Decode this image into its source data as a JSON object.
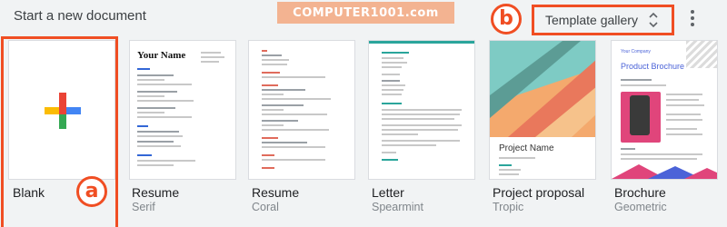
{
  "header": {
    "title": "Start a new document",
    "watermark": "COMPUTER1001.com",
    "gallery_label": "Template gallery"
  },
  "annotations": {
    "a": "a",
    "b": "b"
  },
  "templates": [
    {
      "label": "Blank",
      "sub": ""
    },
    {
      "label": "Resume",
      "sub": "Serif"
    },
    {
      "label": "Resume",
      "sub": "Coral"
    },
    {
      "label": "Letter",
      "sub": "Spearmint"
    },
    {
      "label": "Project proposal",
      "sub": "Tropic"
    },
    {
      "label": "Brochure",
      "sub": "Geometric"
    }
  ],
  "previews": {
    "serif_name": "Your Name",
    "project_name": "Project Name",
    "brochure_company": "Your Company",
    "brochure_title": "Product Brochure"
  },
  "colors": {
    "accent": "#f04e23",
    "background": "#f1f3f4",
    "plus_red": "#ea4335",
    "plus_blue": "#4285f4",
    "plus_green": "#34a853",
    "plus_yellow": "#fbbc04"
  },
  "icons": [
    "plus-icon",
    "unfold-more-icon",
    "more-vert-icon"
  ]
}
